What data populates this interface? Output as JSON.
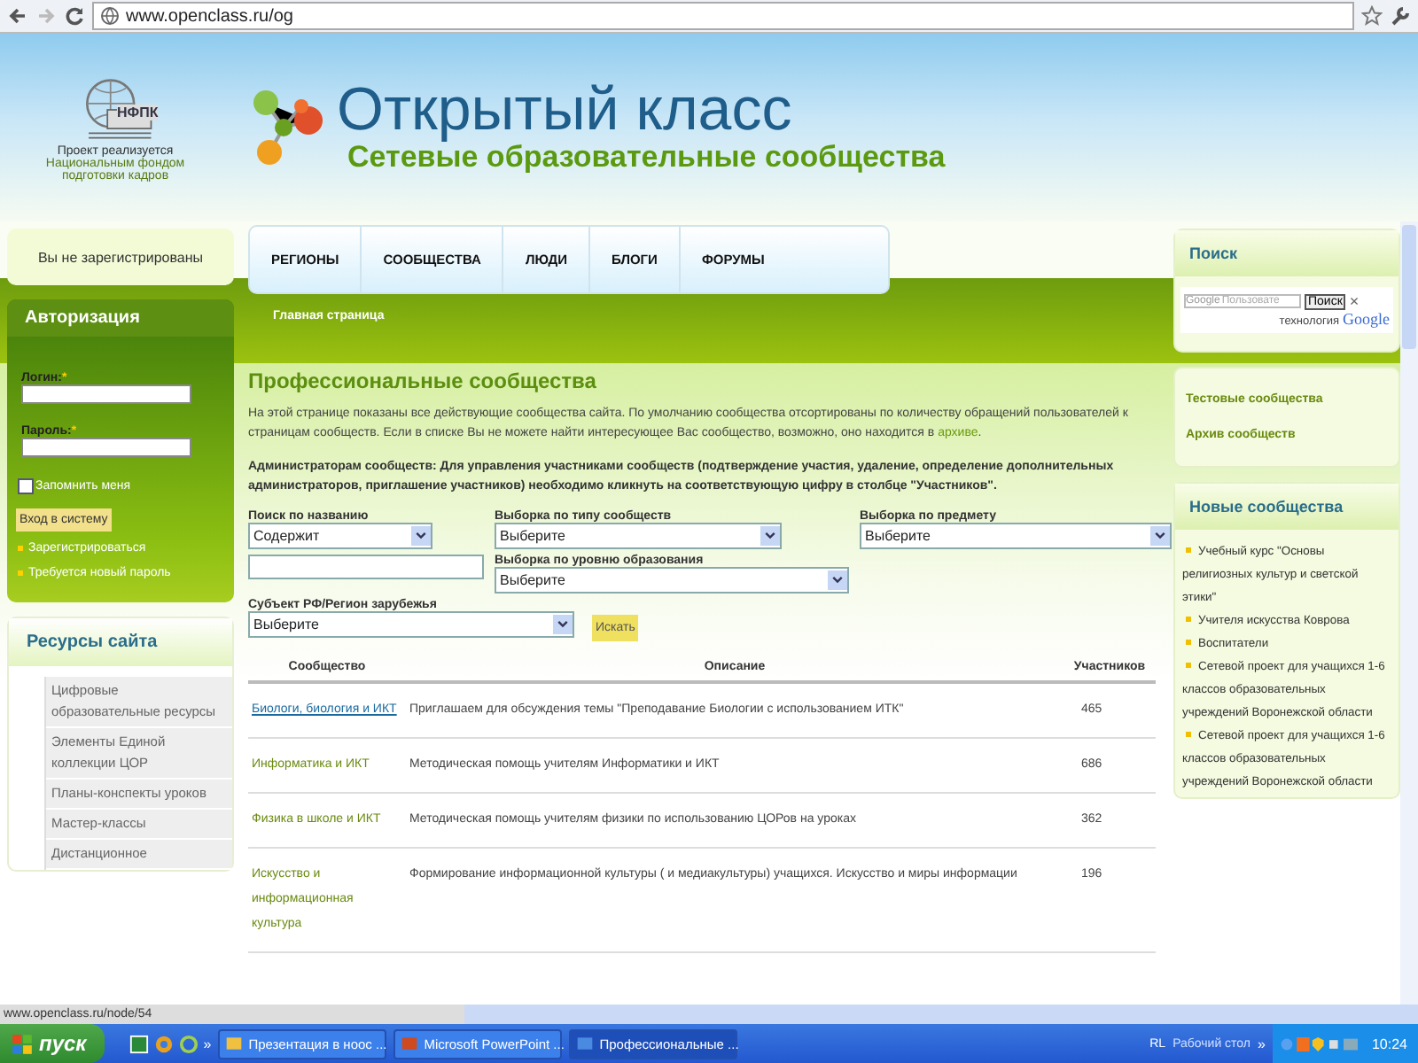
{
  "browser": {
    "url": "www.openclass.ru/og",
    "status_url": "www.openclass.ru/node/54"
  },
  "header": {
    "logo_text": "НФПК",
    "caption_line1": "Проект реализуется",
    "caption_line2": "Национальным фондом подготовки кадров",
    "site_title": "Открытый класс",
    "site_subtitle": "Сетевые образовательные сообщества"
  },
  "nav": {
    "tabs": [
      {
        "label": "РЕГИОНЫ"
      },
      {
        "label": "СООБЩЕСТВА"
      },
      {
        "label": "ЛЮДИ"
      },
      {
        "label": "БЛОГИ"
      },
      {
        "label": "ФОРУМЫ"
      }
    ],
    "breadcrumb": "Главная страница"
  },
  "left": {
    "registration_status": "Вы не зарегистрированы",
    "auth": {
      "title": "Авторизация",
      "fields": [
        {
          "label": "Логин:",
          "mark": "*"
        },
        {
          "label": "Пароль:",
          "mark": "*"
        }
      ],
      "remember_label": "Запомнить меня",
      "remember_checked": false,
      "login_button": "Вход в систему",
      "links": [
        "Зарегистрироваться",
        "Требуется новый пароль"
      ]
    },
    "resources": {
      "title": "Ресурсы сайта",
      "items": [
        "Цифровые образовательные ресурсы",
        "Элементы Единой коллекции ЦОР",
        "Планы-конспекты уроков",
        "Мастер-классы",
        "Дистанционное"
      ]
    }
  },
  "main": {
    "title": "Профессиональные сообщества",
    "intro": "На этой странице показаны все действующие сообщества сайта. По умолчанию сообщества отсортированы по количеству обращений пользователей к страницам сообществ. Если в списке Вы не можете найти интересующее Вас сообщество, возможно, оно находится в",
    "intro_link": "архиве",
    "intro_end": ".",
    "admin_note": "Администраторам сообществ: Для управления участниками сообществ (подтверждение участия, удаление, определение дополнительных администраторов, приглашение участников) необходимо кликнуть на соответствующую цифру в столбце \"Участников\".",
    "filters": [
      {
        "label": "Поиск по названию",
        "value": "Содержит"
      },
      {
        "label": "Выборка по типу сообществ",
        "value": "Выберите"
      },
      {
        "label": "Выборка по предмету",
        "value": "Выберите"
      },
      {
        "label": "Выборка по уровню образования",
        "value": "Выберите"
      },
      {
        "label": "Субъект РФ/Регион зарубежья",
        "value": "Выберите"
      }
    ],
    "search_button": "Искать",
    "table": {
      "columns": [
        "Сообщество",
        "Описание",
        "Участников"
      ],
      "rows": [
        {
          "name": "Биологи, биология и ИКТ",
          "description": "Приглашаем для обсуждения темы \"Преподавание Биологии с использованием ИТК\"",
          "members": "465",
          "selected": true
        },
        {
          "name": "Информатика и ИКТ",
          "description": "Методическая помощь учителям Информатики и ИКТ",
          "members": "686",
          "selected": false
        },
        {
          "name": "Физика в школе и ИКТ",
          "description": "Методическая помощь учителям физики по использованию ЦОРов на уроках",
          "members": "362",
          "selected": false
        },
        {
          "name": "Искусство и информационная культура",
          "description": "Формирование информационной культуры ( и медиакультуры) учащихся. Искусство и миры информации",
          "members": "196",
          "selected": false
        }
      ]
    }
  },
  "right": {
    "search": {
      "title": "Поиск",
      "field_logo": "Google",
      "placeholder": "Пользовате",
      "button": "Поиск",
      "close": "×",
      "powered": "технология",
      "powered_logo": "Google"
    },
    "links": [
      "Тестовые сообщества",
      "Архив сообществ"
    ],
    "new_communities": {
      "title": "Новые сообщества",
      "items": [
        "Учебный курс \"Основы религиозных культур и светской этики\"",
        "Учителя искусства Коврова",
        "Воспитатели",
        "Сетевой проект для учащихся 1-6 классов образовательных учреждений Воронежской области",
        "Сетевой проект для учащихся 1-6 классов образовательных учреждений Воронежской области"
      ]
    }
  },
  "taskbar": {
    "start": "пуск",
    "more": "»",
    "tasks": [
      {
        "label": "Презентация в ноос ...",
        "selected": false
      },
      {
        "label": "Microsoft PowerPoint ...",
        "selected": false
      },
      {
        "label": "Профессиональные ...",
        "selected": true
      }
    ],
    "lang": "RL",
    "desktop": "Рабочий стол",
    "time": "10:24"
  }
}
